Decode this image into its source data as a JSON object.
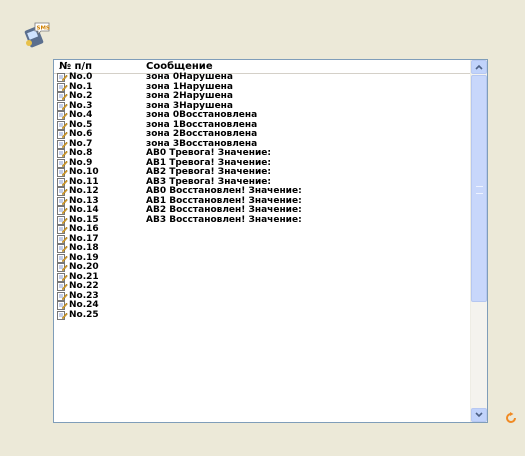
{
  "header": {
    "col_num": "№ п/п",
    "col_msg": "Сообщение"
  },
  "rows": [
    {
      "num": "No.0",
      "msg": "зона 0Нарушена"
    },
    {
      "num": "No.1",
      "msg": "зона 1Нарушена"
    },
    {
      "num": "No.2",
      "msg": "зона 2Нарушена"
    },
    {
      "num": "No.3",
      "msg": "зона 3Нарушена"
    },
    {
      "num": "No.4",
      "msg": "зона 0Восстановлена"
    },
    {
      "num": "No.5",
      "msg": "зона 1Восстановлена"
    },
    {
      "num": "No.6",
      "msg": "зона 2Восстановлена"
    },
    {
      "num": "No.7",
      "msg": "зона 3Восстановлена"
    },
    {
      "num": "No.8",
      "msg": "АВ0 Тревога! Значение:"
    },
    {
      "num": "No.9",
      "msg": "АВ1 Тревога! Значение:"
    },
    {
      "num": "No.10",
      "msg": "АВ2 Тревога! Значение:"
    },
    {
      "num": "No.11",
      "msg": "АВ3 Тревога! Значение:"
    },
    {
      "num": "No.12",
      "msg": "АВ0 Восстановлен! Значение:"
    },
    {
      "num": "No.13",
      "msg": "АВ1 Восстановлен! Значение:"
    },
    {
      "num": "No.14",
      "msg": "АВ2 Восстановлен! Значение:"
    },
    {
      "num": "No.15",
      "msg": "АВ3 Восстановлен! Значение:"
    },
    {
      "num": "No.16",
      "msg": ""
    },
    {
      "num": "No.17",
      "msg": ""
    },
    {
      "num": "No.18",
      "msg": ""
    },
    {
      "num": "No.19",
      "msg": ""
    },
    {
      "num": "No.20",
      "msg": ""
    },
    {
      "num": "No.21",
      "msg": ""
    },
    {
      "num": "No.22",
      "msg": ""
    },
    {
      "num": "No.23",
      "msg": ""
    },
    {
      "num": "No.24",
      "msg": ""
    },
    {
      "num": "No.25",
      "msg": ""
    }
  ],
  "icons": {
    "app": "sms-icon",
    "row": "document-edit-icon",
    "refresh": "refresh-icon"
  },
  "colors": {
    "background": "#ece9d8",
    "list_border": "#7f9db9",
    "scroll_thumb": "#c8d7fb",
    "refresh": "#f08a24"
  }
}
